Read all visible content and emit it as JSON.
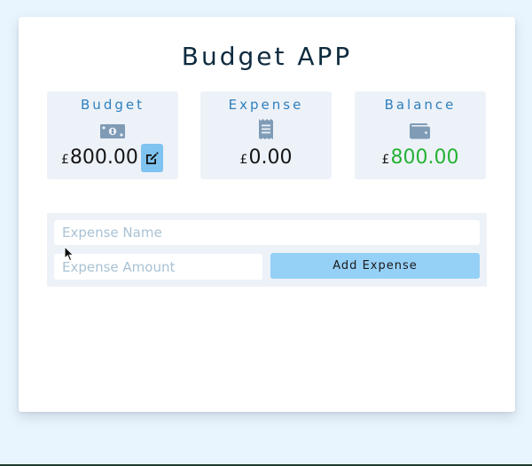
{
  "app": {
    "title": "Budget APP"
  },
  "stats": {
    "budget": {
      "label": "Budget",
      "currency": "£",
      "value": "800.00",
      "icon": "money-bill-icon"
    },
    "expense": {
      "label": "Expense",
      "currency": "£",
      "value": "0.00",
      "icon": "receipt-icon"
    },
    "balance": {
      "label": "Balance",
      "currency": "£",
      "value": "800.00",
      "icon": "wallet-icon"
    }
  },
  "form": {
    "name_placeholder": "Expense Name",
    "name_value": "",
    "amount_placeholder": "Expense Amount",
    "amount_value": "",
    "add_label": "Add Expense"
  },
  "colors": {
    "background": "#e9f5fe",
    "title": "#0e2b3f",
    "label": "#2e7fbd",
    "icon": "#7f9bb5",
    "balance_value": "#25b236",
    "button": "#95d0f7",
    "edit_button": "#7fc3f1"
  }
}
